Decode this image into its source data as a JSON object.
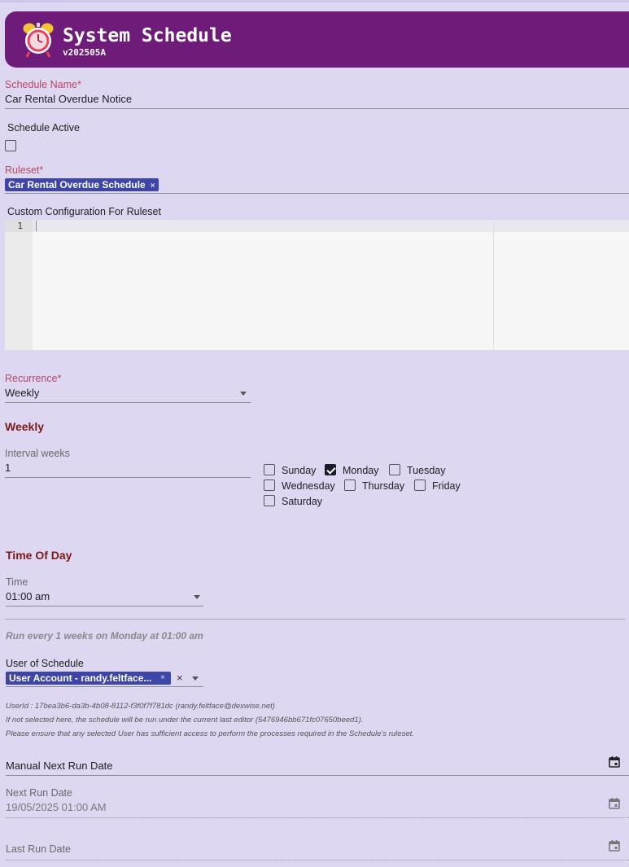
{
  "header": {
    "title": "System Schedule",
    "version": "v202505A",
    "icon": "alarm-clock-icon"
  },
  "form": {
    "schedule_name": {
      "label": "Schedule Name",
      "required_mark": "*",
      "value": "Car Rental Overdue Notice"
    },
    "schedule_active": {
      "label": "Schedule Active",
      "checked": false
    },
    "ruleset": {
      "label": "Ruleset",
      "required_mark": "*",
      "chip": "Car Rental Overdue Schedule",
      "chip_remove": "×"
    },
    "custom_config": {
      "label": "Custom Configuration For Ruleset",
      "line_number": "1"
    },
    "recurrence": {
      "label": "Recurrence",
      "required_mark": "*",
      "value": "Weekly"
    },
    "weekly": {
      "heading": "Weekly",
      "interval_label": "Interval weeks",
      "interval_value": "1",
      "days": [
        {
          "label": "Sunday",
          "checked": false
        },
        {
          "label": "Monday",
          "checked": true
        },
        {
          "label": "Tuesday",
          "checked": false
        },
        {
          "label": "Wednesday",
          "checked": false
        },
        {
          "label": "Thursday",
          "checked": false
        },
        {
          "label": "Friday",
          "checked": false
        },
        {
          "label": "Saturday",
          "checked": false
        }
      ]
    },
    "time_of_day": {
      "heading": "Time Of Day",
      "time_label": "Time",
      "time_value": "01:00 am"
    },
    "summary": "Run every 1 weeks on Monday at 01:00 am",
    "user_of_schedule": {
      "label": "User of Schedule",
      "chip": "User Account - randy.feltface...",
      "chip_remove": "×",
      "clear": "×"
    },
    "notes": [
      "UserId : 17bea3b6-da3b-4b08-8112-f3f0f7f781dc (randy.feltface@dexwise.net)",
      "If not selected here, the schedule will be run under the current last editor (5476946bb671fc07650beed1).",
      "Please ensure that any selected User has sufficient access to perform the processes required in the Schedule's ruleset."
    ],
    "manual_next_run": {
      "label": "Manual Next Run Date"
    },
    "next_run": {
      "label": "Next Run Date",
      "value": "19/05/2025 01:00 AM"
    },
    "last_run": {
      "label": "Last Run Date",
      "value": ""
    }
  },
  "colors": {
    "background": "#ddd7f1",
    "header": "#6e1b7a",
    "chip": "#3d46a8",
    "required_label": "#b8485f",
    "section_heading": "#7a1a1a"
  }
}
